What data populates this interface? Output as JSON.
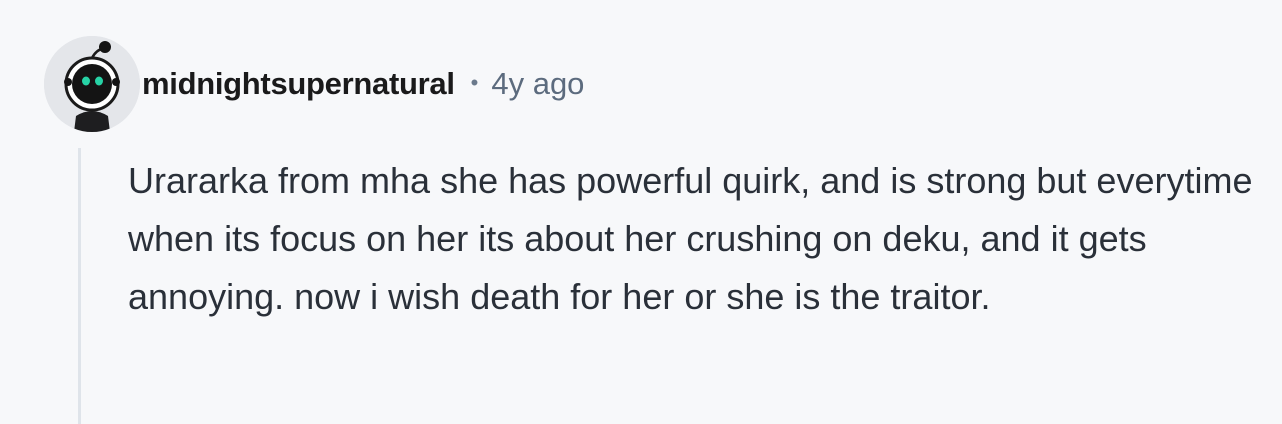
{
  "comment": {
    "author": {
      "username": "midnightsupernatural",
      "avatar": "avatar-icon"
    },
    "separator": "•",
    "timestamp": "4y ago",
    "body": "Urararka from mha she has powerful quirk, and is strong but everytime when its focus on her its about her crushing on deku, and it gets annoying. now i wish death for her or she is the traitor."
  },
  "colors": {
    "background": "#f7f8fa",
    "username": "#1a1a1b",
    "meta": "#5c6b7e",
    "body_text": "#2a3039",
    "thread_line": "#dfe4ea"
  }
}
